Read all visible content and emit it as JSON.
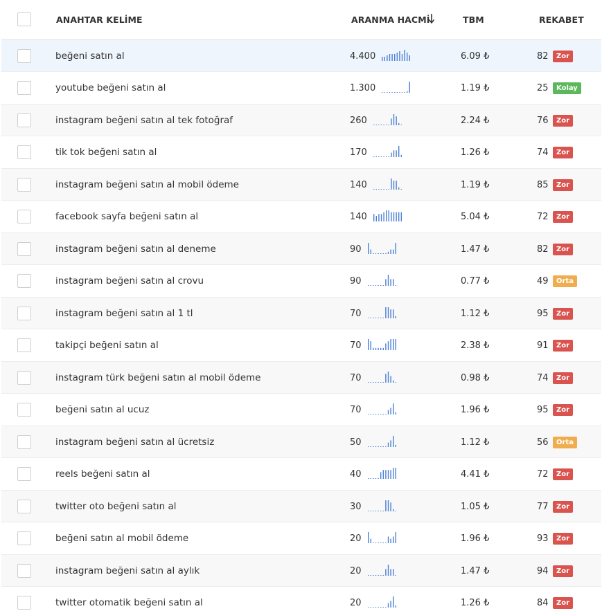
{
  "header": {
    "keyword": "ANAHTAR KELİME",
    "volume": "ARANMA HACMİ",
    "cpc": "TBM",
    "competition": "REKABET"
  },
  "colors": {
    "zor": "#d9534f",
    "orta": "#f0ad4e",
    "kolay": "#5cb85c",
    "spark": "#4a7fd4"
  },
  "rows": [
    {
      "keyword": "beğeni satın al",
      "volume": "4.400",
      "cpc": "6.09 ₺",
      "score": "82",
      "difficulty": "Zor",
      "trend": [
        3,
        3,
        4,
        5,
        5,
        5,
        6,
        7,
        5,
        8,
        6,
        4
      ]
    },
    {
      "keyword": "youtube beğeni satın al",
      "volume": "1.300",
      "cpc": "1.19 ₺",
      "score": "25",
      "difficulty": "Kolay",
      "trend": [
        0,
        0,
        0,
        0,
        0,
        0,
        0,
        0,
        0,
        0,
        1,
        9
      ]
    },
    {
      "keyword": "instagram beğeni satın al tek fotoğraf",
      "volume": "260",
      "cpc": "2.24 ₺",
      "score": "76",
      "difficulty": "Zor",
      "trend": [
        0,
        0,
        0,
        0,
        0,
        0,
        0,
        3,
        5,
        4,
        1,
        0
      ]
    },
    {
      "keyword": "tik tok beğeni satın al",
      "volume": "170",
      "cpc": "1.26 ₺",
      "score": "74",
      "difficulty": "Zor",
      "trend": [
        0,
        0,
        0,
        0,
        0,
        0,
        0,
        2,
        3,
        3,
        5,
        1
      ]
    },
    {
      "keyword": "instagram beğeni satın al mobil ödeme",
      "volume": "140",
      "cpc": "1.19 ₺",
      "score": "85",
      "difficulty": "Zor",
      "trend": [
        0,
        0,
        0,
        0,
        0,
        0,
        0,
        5,
        4,
        4,
        1,
        0
      ]
    },
    {
      "keyword": "facebook sayfa beğeni satın al",
      "volume": "140",
      "cpc": "5.04 ₺",
      "score": "72",
      "difficulty": "Zor",
      "trend": [
        4,
        3,
        4,
        4,
        5,
        6,
        6,
        5,
        5,
        5,
        5,
        5
      ]
    },
    {
      "keyword": "instagram beğeni satın al deneme",
      "volume": "90",
      "cpc": "1.47 ₺",
      "score": "82",
      "difficulty": "Zor",
      "trend": [
        5,
        2,
        0,
        0,
        0,
        0,
        0,
        0,
        1,
        2,
        2,
        5
      ]
    },
    {
      "keyword": "instagram beğeni satın al crovu",
      "volume": "90",
      "cpc": "0.77 ₺",
      "score": "49",
      "difficulty": "Orta",
      "trend": [
        0,
        0,
        0,
        0,
        0,
        0,
        0,
        3,
        5,
        3,
        3,
        0
      ]
    },
    {
      "keyword": "instagram beğeni satın al 1 tl",
      "volume": "70",
      "cpc": "1.12 ₺",
      "score": "95",
      "difficulty": "Zor",
      "trend": [
        0,
        0,
        0,
        0,
        0,
        0,
        0,
        5,
        5,
        4,
        4,
        1
      ]
    },
    {
      "keyword": "takipçi beğeni satın al",
      "volume": "70",
      "cpc": "2.38 ₺",
      "score": "91",
      "difficulty": "Zor",
      "trend": [
        5,
        4,
        1,
        1,
        1,
        1,
        1,
        3,
        4,
        5,
        5,
        5
      ]
    },
    {
      "keyword": "instagram türk beğeni satın al mobil ödeme",
      "volume": "70",
      "cpc": "0.98 ₺",
      "score": "74",
      "difficulty": "Zor",
      "trend": [
        0,
        0,
        0,
        0,
        0,
        0,
        0,
        4,
        5,
        3,
        1,
        0
      ]
    },
    {
      "keyword": "beğeni satın al ucuz",
      "volume": "70",
      "cpc": "1.96 ₺",
      "score": "95",
      "difficulty": "Zor",
      "trend": [
        0,
        0,
        0,
        0,
        0,
        0,
        0,
        0,
        2,
        3,
        5,
        1
      ]
    },
    {
      "keyword": "instagram beğeni satın al ücretsiz",
      "volume": "50",
      "cpc": "1.12 ₺",
      "score": "56",
      "difficulty": "Orta",
      "trend": [
        0,
        0,
        0,
        0,
        0,
        0,
        0,
        0,
        2,
        3,
        5,
        1
      ]
    },
    {
      "keyword": "reels beğeni satın al",
      "volume": "40",
      "cpc": "4.41 ₺",
      "score": "72",
      "difficulty": "Zor",
      "trend": [
        0,
        0,
        0,
        0,
        0,
        3,
        4,
        4,
        4,
        4,
        5,
        5
      ]
    },
    {
      "keyword": "twitter oto beğeni satın al",
      "volume": "30",
      "cpc": "1.05 ₺",
      "score": "77",
      "difficulty": "Zor",
      "trend": [
        0,
        0,
        0,
        0,
        0,
        0,
        0,
        5,
        5,
        4,
        1,
        0
      ]
    },
    {
      "keyword": "beğeni satın al mobil ödeme",
      "volume": "20",
      "cpc": "1.96 ₺",
      "score": "93",
      "difficulty": "Zor",
      "trend": [
        5,
        2,
        0,
        0,
        0,
        0,
        0,
        0,
        3,
        2,
        3,
        5
      ]
    },
    {
      "keyword": "instagram beğeni satın al aylık",
      "volume": "20",
      "cpc": "1.47 ₺",
      "score": "94",
      "difficulty": "Zor",
      "trend": [
        0,
        0,
        0,
        0,
        0,
        0,
        0,
        3,
        5,
        3,
        3,
        0
      ]
    },
    {
      "keyword": "twitter otomatik beğeni satın al",
      "volume": "20",
      "cpc": "1.26 ₺",
      "score": "84",
      "difficulty": "Zor",
      "trend": [
        0,
        0,
        0,
        0,
        0,
        0,
        0,
        0,
        2,
        3,
        5,
        1
      ]
    }
  ]
}
